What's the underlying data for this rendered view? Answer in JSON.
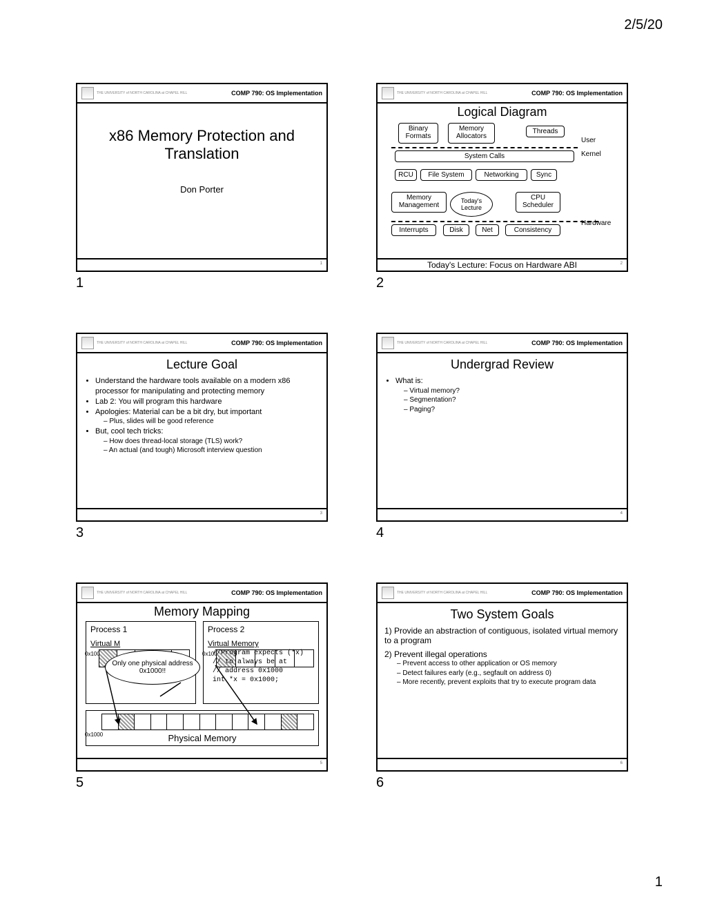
{
  "page": {
    "date": "2/5/20",
    "number": "1"
  },
  "course": "COMP 790: OS Implementation",
  "univ": "THE UNIVERSITY of NORTH CAROLINA at CHAPEL HILL",
  "slides": {
    "s1": {
      "num": "1",
      "title": "x86 Memory Protection and Translation",
      "author": "Don Porter",
      "fnum": "1"
    },
    "s2": {
      "num": "2",
      "title": "Logical Diagram",
      "boxes": {
        "bf": "Binary Formats",
        "ma": "Memory Allocators",
        "th": "Threads",
        "sc": "System Calls",
        "rcu": "RCU",
        "fs": "File System",
        "nw": "Networking",
        "sy": "Sync",
        "mm": "Memory Management",
        "tl": "Today's Lecture",
        "cs": "CPU Scheduler",
        "int": "Interrupts",
        "disk": "Disk",
        "net": "Net",
        "con": "Consistency"
      },
      "labels": {
        "user": "User",
        "kernel": "Kernel",
        "hw": "Hardware"
      },
      "footer": "Today's Lecture: Focus on Hardware ABI",
      "fnum": "2"
    },
    "s3": {
      "num": "3",
      "title": "Lecture Goal",
      "b1": "Understand the hardware tools available on a modern x86 processor for manipulating and protecting memory",
      "b2": "Lab 2: You will program this hardware",
      "b3": "Apologies: Material can be a bit dry, but important",
      "b3a": "Plus, slides will be good reference",
      "b4": "But, cool tech tricks:",
      "b4a": "How does thread-local storage (TLS) work?",
      "b4b": "An actual (and tough) Microsoft interview question",
      "fnum": "3"
    },
    "s4": {
      "num": "4",
      "title": "Undergrad Review",
      "b1": "What is:",
      "b1a": "Virtual memory?",
      "b1b": "Segmentation?",
      "b1c": "Paging?",
      "fnum": "4"
    },
    "s5": {
      "num": "5",
      "title": "Memory Mapping",
      "p1": "Process 1",
      "p2": "Process 2",
      "vm": "Virtual Memory",
      "addr1": "0x1000",
      "addr2": "0x1000",
      "bubble": "Only one physical address 0x1000!!",
      "code1": "//Program expects (*x)",
      "code2": "// to always be at",
      "code3": "// address 0x1000",
      "code4": "int *x = 0x1000;",
      "pm": "Physical Memory",
      "pmaddr": "0x1000",
      "fnum": "5"
    },
    "s6": {
      "num": "6",
      "title": "Two System Goals",
      "g1": "1) Provide an abstraction of contiguous, isolated virtual memory to a program",
      "g2": "2) Prevent illegal operations",
      "g2a": "Prevent access to other application or OS memory",
      "g2b": "Detect failures early (e.g., segfault on address 0)",
      "g2c": "More recently, prevent exploits that try to execute program data",
      "fnum": "6"
    }
  }
}
